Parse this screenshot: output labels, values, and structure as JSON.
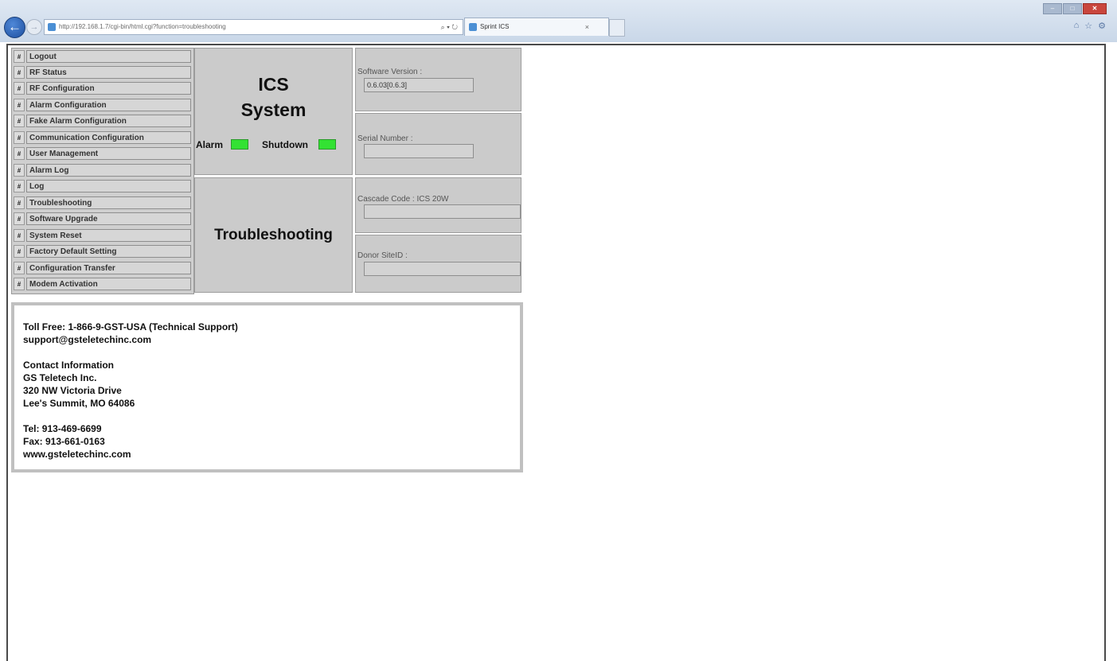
{
  "browser": {
    "url": "http://192.168.1.7/cgi-bin/html.cgi?function=troubleshooting",
    "address_controls": "⌕ ▾ ↻",
    "tab_title": "Sprint ICS",
    "tab_close": "×"
  },
  "nav": {
    "marker": "#",
    "items": [
      {
        "label": "Logout"
      },
      {
        "label": "RF Status"
      },
      {
        "label": "RF Configuration"
      },
      {
        "label": "Alarm Configuration"
      },
      {
        "label": "Fake Alarm Configuration"
      },
      {
        "label": "Communication Configuration"
      },
      {
        "label": "User Management"
      },
      {
        "label": "Alarm Log"
      },
      {
        "label": "Log"
      },
      {
        "label": "Troubleshooting"
      },
      {
        "label": "Software Upgrade"
      },
      {
        "label": "System Reset"
      },
      {
        "label": "Factory Default Setting"
      },
      {
        "label": "Configuration Transfer"
      },
      {
        "label": "Modem Activation"
      }
    ]
  },
  "status": {
    "title_line1": "ICS",
    "title_line2": "System",
    "alarm_label": "Alarm",
    "shutdown_label": "Shutdown",
    "led_color": "#33e233"
  },
  "page": {
    "title": "Troubleshooting"
  },
  "info": {
    "software_version_label": "Software Version :",
    "software_version_value": "0.6.03[0.6.3]",
    "serial_number_label": "Serial Number :",
    "serial_number_value": "",
    "cascade_code_label": "Cascade Code : ICS 20W",
    "cascade_code_value": "",
    "donor_siteid_label": "Donor SiteID :",
    "donor_siteid_value": ""
  },
  "contact": {
    "toll_free": "Toll Free: 1-866-9-GST-USA (Technical Support)",
    "email": "support@gsteletechinc.com",
    "heading": "Contact Information",
    "company": "GS Teletech Inc.",
    "street": "320 NW Victoria Drive",
    "city": "Lee's Summit, MO 64086",
    "tel": "Tel: 913-469-6699",
    "fax": "Fax: 913-661-0163",
    "website": "www.gsteletechinc.com"
  }
}
